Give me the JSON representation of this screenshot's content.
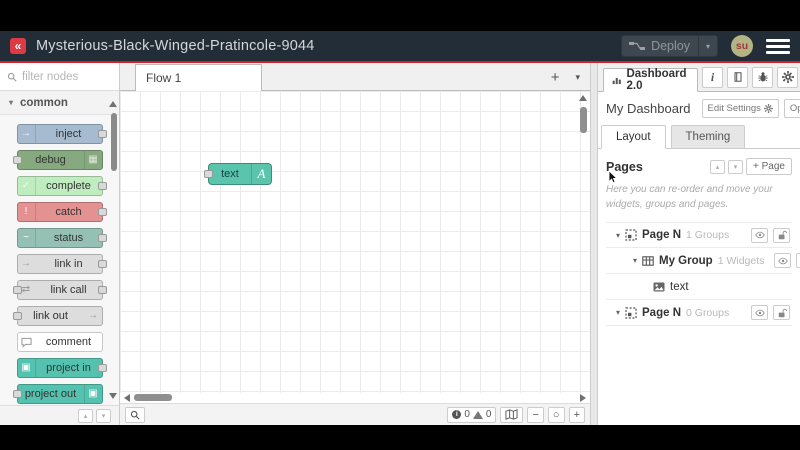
{
  "header": {
    "title": "Mysterious-Black-Winged-Pratincole-9044",
    "deploy_label": "Deploy",
    "avatar": "su"
  },
  "palette": {
    "search_placeholder": "filter nodes",
    "category": "common",
    "nodes": [
      {
        "label": "inject",
        "color": "#a6bbcf"
      },
      {
        "label": "debug",
        "color": "#87a980"
      },
      {
        "label": "complete",
        "color": "#c0edc0"
      },
      {
        "label": "catch",
        "color": "#e49191"
      },
      {
        "label": "status",
        "color": "#94c1b4"
      },
      {
        "label": "link in",
        "color": "#dddddd"
      },
      {
        "label": "link call",
        "color": "#dddddd"
      },
      {
        "label": "link out",
        "color": "#dddddd"
      },
      {
        "label": "comment",
        "color": "#ffffff"
      },
      {
        "label": "project in",
        "color": "#55c2b0"
      },
      {
        "label": "project out",
        "color": "#55c2b0"
      }
    ]
  },
  "canvas": {
    "tab_label": "Flow 1",
    "node": {
      "label": "text",
      "color": "#5bc4ac",
      "icon_glyph": "A"
    },
    "footer": {
      "info_count": "0",
      "warning_count": "0"
    }
  },
  "sidebar": {
    "tab_label": "Dashboard 2.0",
    "dashboard_name": "My Dashboard",
    "edit_settings_label": "Edit Settings",
    "open_dashboard_label": "Open Dashboard",
    "layout_tab": "Layout",
    "theming_tab": "Theming",
    "pages_title": "Pages",
    "add_page_label": "+ Page",
    "help_text": "Here you can re-order and move your widgets, groups and pages.",
    "tree": [
      {
        "name": "Page N",
        "count": "1 Groups"
      },
      {
        "name": "My Group",
        "count": "1 Widgets"
      },
      {
        "name": "text",
        "count": ""
      },
      {
        "name": "Page N",
        "count": "0 Groups"
      }
    ]
  },
  "icons": {
    "logo": "«",
    "inject": "→",
    "debug": "▦",
    "complete": "✓",
    "catch": "!",
    "status": "~",
    "link_in": "→",
    "link_call": "⇄",
    "link_out": "→",
    "comment": "“",
    "project": "▣",
    "chevron_down": "▾",
    "up": "▴",
    "down": "▾",
    "plus": "+",
    "minus": "−",
    "circle": "○",
    "info": "i"
  },
  "colors": {
    "accent_red": "#d3212c",
    "logo_red": "#dc3a45",
    "header_bg": "#232d37"
  }
}
